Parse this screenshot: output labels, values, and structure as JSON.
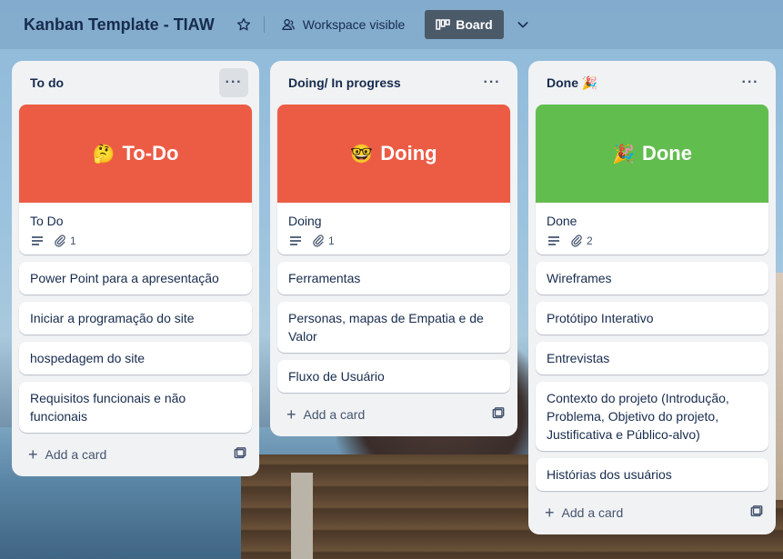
{
  "header": {
    "title": "Kanban Template - TIAW",
    "visibility_label": "Workspace visible",
    "view_label": "Board"
  },
  "colors": {
    "todo_cover": "#ec5c45",
    "doing_cover": "#ec5c45",
    "done_cover": "#62bd4f"
  },
  "lists": [
    {
      "title": "To do",
      "cover": {
        "emoji": "🤔",
        "text": "To-Do"
      },
      "cover_card": {
        "title": "To Do",
        "attachments": "1"
      },
      "cards": [
        "Power Point para a apresentação",
        "Iniciar a programação do site",
        "hospedagem do site",
        "Requisitos funcionais e não funcionais"
      ],
      "add_card_label": "Add a card"
    },
    {
      "title": "Doing/ In progress",
      "cover": {
        "emoji": "🤓",
        "text": "Doing"
      },
      "cover_card": {
        "title": "Doing",
        "attachments": "1"
      },
      "cards": [
        "Ferramentas",
        "Personas, mapas de Empatia e de Valor",
        "Fluxo de Usuário"
      ],
      "add_card_label": "Add a card"
    },
    {
      "title": "Done 🎉",
      "cover": {
        "emoji": "🎉",
        "text": "Done"
      },
      "cover_card": {
        "title": "Done",
        "attachments": "2"
      },
      "cards": [
        "Wireframes",
        "Protótipo Interativo",
        "Entrevistas",
        "Contexto do projeto (Introdução, Problema, Objetivo do projeto, Justificativa e Público-alvo)",
        "Histórias dos usuários"
      ],
      "add_card_label": "Add a card"
    }
  ]
}
